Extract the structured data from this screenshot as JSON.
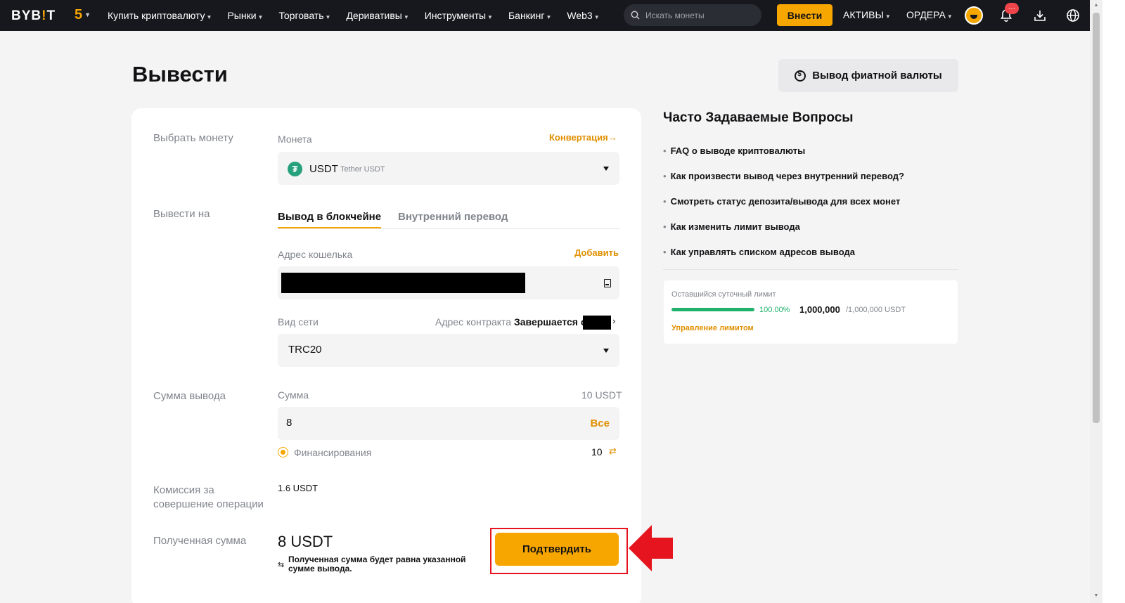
{
  "nav": {
    "logo_a": "BYB",
    "logo_b": "!",
    "logo_c": "T",
    "anniversary": "5",
    "items": [
      {
        "label": "Купить криптовалюту"
      },
      {
        "label": "Рынки"
      },
      {
        "label": "Торговать"
      },
      {
        "label": "Деривативы"
      },
      {
        "label": "Инструменты"
      },
      {
        "label": "Банкинг"
      },
      {
        "label": "Web3"
      }
    ],
    "search_placeholder": "Искать монеты",
    "deposit_label": "Внести",
    "assets_label": "АКТИВЫ",
    "orders_label": "ОРДЕРА",
    "notification_badge": "···"
  },
  "page": {
    "title": "Вывести",
    "fiat_button": "Вывод фиатной валюты"
  },
  "form": {
    "select_coin_label": "Выбрать монету",
    "coin_label": "Монета",
    "convert_link": "Конвертация→",
    "coin_ticker": "USDT",
    "coin_name": "Tether USDT",
    "coin_icon_glyph": "₮",
    "withdraw_to_label": "Вывести на",
    "tab_onchain": "Вывод в блокчейне",
    "tab_internal": "Внутренний перевод",
    "wallet_label": "Адрес кошелька",
    "add_link": "Добавить",
    "network_label": "Вид сети",
    "contract_prefix": "Адрес контракта",
    "contract_ends": "Завершается с",
    "network_value": "TRC20",
    "amount_section_label": "Сумма вывода",
    "amount_label": "Сумма",
    "amount_balance": "10 USDT",
    "amount_value": "8",
    "all_button": "Все",
    "funding_label": "Финансирования",
    "funding_value": "10",
    "fee_label": "Комиссия за совершение операции",
    "fee_value": "1.6 USDT",
    "received_label": "Полученная сумма",
    "received_value": "8 USDT",
    "received_note": "Полученная сумма будет равна указанной сумме вывода.",
    "confirm_button": "Подтвердить"
  },
  "faq": {
    "title": "Часто Задаваемые Вопросы",
    "items": [
      "FAQ о выводе криптовалюты",
      "Как произвести вывод через внутренний перевод?",
      "Смотреть статус депозита/вывода для всех монет",
      "Как изменить лимит вывода",
      "Как управлять списком адресов вывода"
    ]
  },
  "limit": {
    "label": "Оставшийся суточный лимит",
    "percent": "100.00%",
    "remaining": "1,000,000",
    "total": "/1,000,000 USDT",
    "manage_link": "Управление лимитом",
    "fill_fraction": 1.0
  },
  "colors": {
    "accent": "#f7a600",
    "highlight_outline": "#e5141e",
    "success": "#20b26c",
    "topbar": "#17181e"
  },
  "icons": [
    "search-icon",
    "bell-icon",
    "download-icon",
    "globe-icon",
    "address-book-icon",
    "swap-icon",
    "arrow-pointer-icon"
  ]
}
